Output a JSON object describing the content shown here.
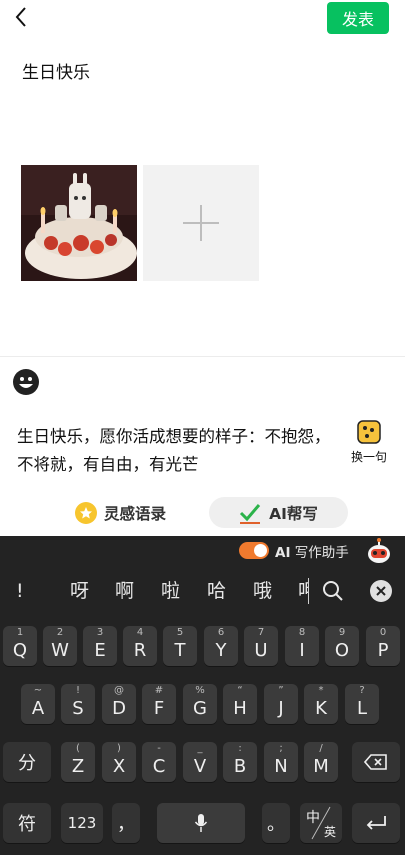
{
  "header": {
    "publish_label": "发表"
  },
  "post": {
    "text": "生日快乐"
  },
  "composer": {
    "suggestion_text": "生日快乐，愿你活成想要的样子：不抱怨，不将就，有自由，有光芒",
    "swap_label": "换一句",
    "inspiration_label": "灵感语录",
    "ai_write_label": "AI帮写"
  },
  "keyboard": {
    "ai_assistant_prefix": "AI",
    "ai_assistant_label": "写作助手",
    "candidates": [
      "!",
      "呀",
      "啊",
      "啦",
      "哈",
      "哦",
      "呷"
    ],
    "row1": [
      {
        "hint": "1",
        "key": "Q"
      },
      {
        "hint": "2",
        "key": "W"
      },
      {
        "hint": "3",
        "key": "E"
      },
      {
        "hint": "4",
        "key": "R"
      },
      {
        "hint": "5",
        "key": "T"
      },
      {
        "hint": "6",
        "key": "Y"
      },
      {
        "hint": "7",
        "key": "U"
      },
      {
        "hint": "8",
        "key": "I"
      },
      {
        "hint": "9",
        "key": "O"
      },
      {
        "hint": "0",
        "key": "P"
      }
    ],
    "row2": [
      {
        "hint": "~",
        "key": "A"
      },
      {
        "hint": "!",
        "key": "S"
      },
      {
        "hint": "@",
        "key": "D"
      },
      {
        "hint": "#",
        "key": "F"
      },
      {
        "hint": "%",
        "key": "G"
      },
      {
        "hint": "“",
        "key": "H"
      },
      {
        "hint": "”",
        "key": "J"
      },
      {
        "hint": "*",
        "key": "K"
      },
      {
        "hint": "?",
        "key": "L"
      }
    ],
    "row3": [
      {
        "hint": "(",
        "key": "Z"
      },
      {
        "hint": ")",
        "key": "X"
      },
      {
        "hint": "-",
        "key": "C"
      },
      {
        "hint": "_",
        "key": "V"
      },
      {
        "hint": ":",
        "key": "B"
      },
      {
        "hint": ";",
        "key": "N"
      },
      {
        "hint": "/",
        "key": "M"
      }
    ],
    "fen": "分",
    "fu": "符",
    "num": "123",
    "comma": "，",
    "period": "。",
    "lang_main": "中",
    "lang_sub": "英"
  }
}
